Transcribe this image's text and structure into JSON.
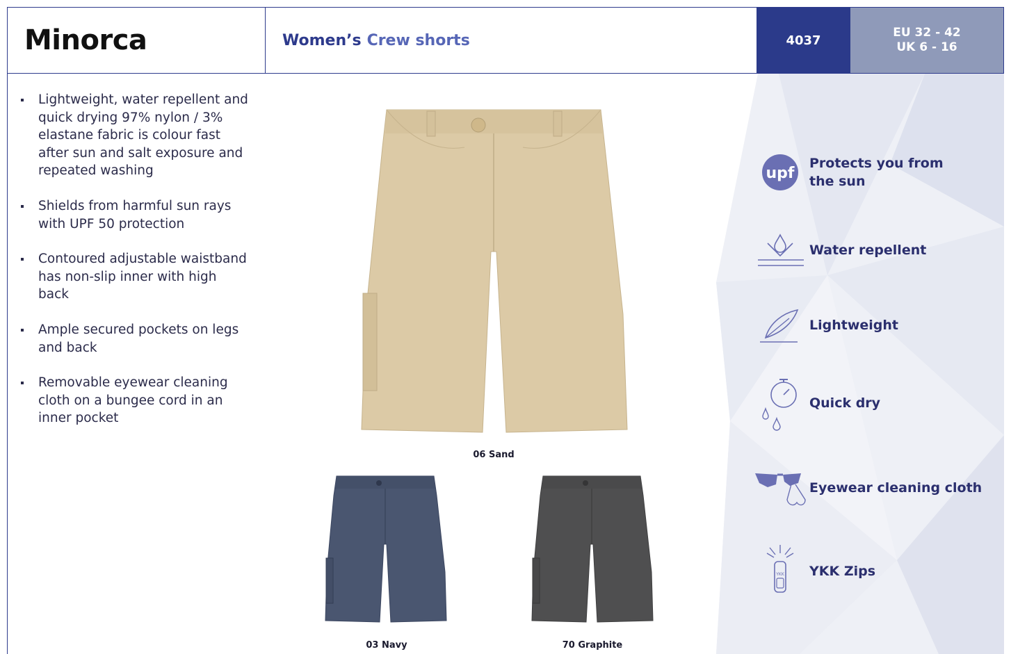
{
  "header": {
    "product_name": "Minorca",
    "subtitle_prefix": "Women’s",
    "subtitle_rest": "Crew shorts",
    "style_code": "4037",
    "size_eu": "EU 32 - 42",
    "size_uk": "UK 6 - 16"
  },
  "colors": {
    "brand_navy": "#2b3a8a",
    "size_box": "#8f9ab9",
    "sand": "#dccaa6",
    "navy": "#4a5670",
    "graphite": "#4f4f50"
  },
  "features_list": [
    "Lightweight, water repellent and quick drying 97% nylon / 3% elastane fabric is colour fast after sun and salt exposure and repeated washing",
    "Shields from harmful sun rays with UPF 50 protection",
    "Contoured adjustable waistband has non-slip inner with high back",
    "Ample secured pockets on legs and back",
    "Removable eyewear cleaning cloth on a bungee cord in an inner pocket"
  ],
  "products": [
    {
      "caption": "06 Sand"
    },
    {
      "caption": "03 Navy"
    },
    {
      "caption": "70 Graphite"
    }
  ],
  "features": [
    {
      "icon": "upf-icon",
      "icon_text": "upf",
      "label_line1": "Protects you from",
      "label_line2": "the sun"
    },
    {
      "icon": "water-repellent-icon",
      "label_line1": "Water repellent"
    },
    {
      "icon": "feather-icon",
      "label_line1": "Lightweight"
    },
    {
      "icon": "stopwatch-drops-icon",
      "label_line1": "Quick dry"
    },
    {
      "icon": "sunglasses-cloth-icon",
      "label_line1": "Eyewear cleaning cloth"
    },
    {
      "icon": "zip-pull-icon",
      "icon_text": "YKK",
      "label_line1": "YKK Zips"
    }
  ]
}
